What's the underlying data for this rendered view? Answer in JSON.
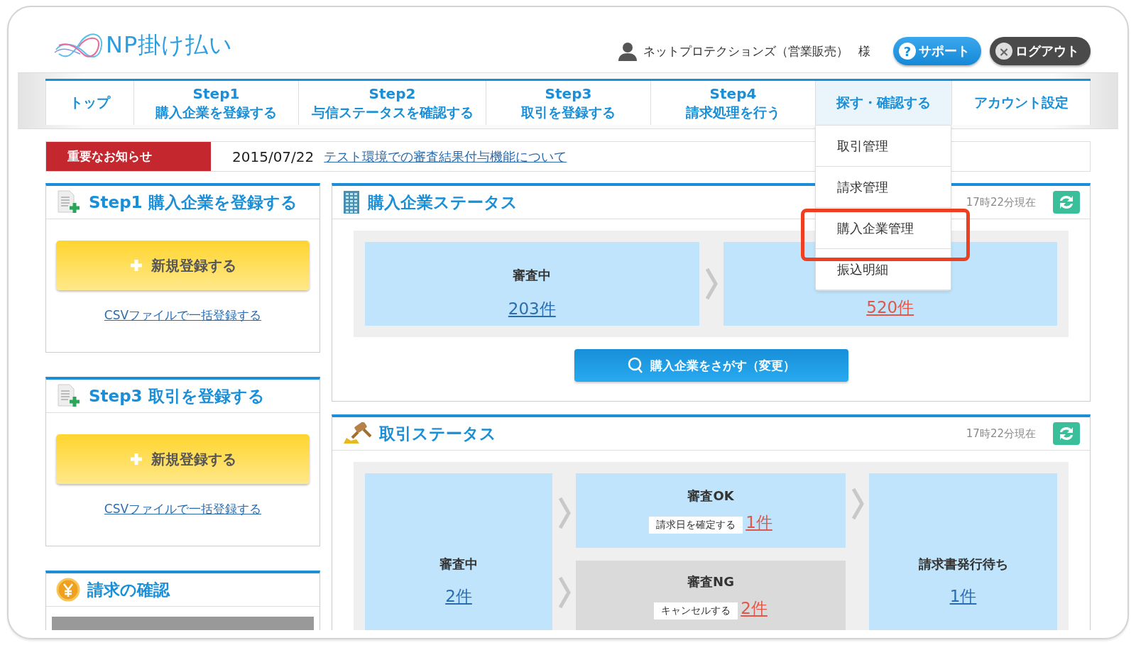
{
  "logo": {
    "text": "NP掛け払い"
  },
  "user": {
    "name": "ネットプロテクションズ（営業販売）",
    "honorific": "様"
  },
  "header_buttons": [
    {
      "kind": "support",
      "icon": "?",
      "label": "サポート"
    },
    {
      "kind": "logout",
      "icon": "×",
      "label": "ログアウト"
    }
  ],
  "nav": {
    "tabs": [
      {
        "label": "トップ",
        "selected": false
      },
      {
        "step": "Step1",
        "label": "購入企業を登録する",
        "selected": false
      },
      {
        "step": "Step2",
        "label": "与信ステータスを確認する",
        "selected": false
      },
      {
        "step": "Step3",
        "label": "取引を登録する",
        "selected": false
      },
      {
        "step": "Step4",
        "label": "請求処理を行う",
        "selected": false
      },
      {
        "label": "探す・確認する",
        "selected": true,
        "expanded": true
      },
      {
        "label": "アカウント設定",
        "selected": false
      }
    ]
  },
  "dropdown": {
    "items": [
      {
        "label": "取引管理",
        "highlighted": false
      },
      {
        "label": "請求管理",
        "highlighted": false
      },
      {
        "label": "購入企業管理",
        "highlighted": true
      },
      {
        "label": "振込明細",
        "highlighted": false
      }
    ]
  },
  "notice": {
    "badge": "重要なお知らせ",
    "date": "2015/07/22",
    "link": "テスト環境での審査結果付与機能について"
  },
  "left_cards": [
    {
      "kind": "register",
      "title": "Step1 購入企業を登録する",
      "button": "新規登録する",
      "link": "CSVファイルで一括登録する"
    },
    {
      "kind": "register",
      "title": "Step3 取引を登録する",
      "button": "新規登録する",
      "link": "CSVファイルで一括登録する"
    },
    {
      "kind": "billing",
      "title": "請求の確認"
    }
  ],
  "company_status": {
    "title": "購入企業ステータス",
    "time": "17時22分現在",
    "stages": [
      {
        "label": "審査中",
        "count": "203件",
        "alert": false
      },
      {
        "count": "520件",
        "alert": true
      }
    ],
    "search_button": "購入企業をさがす（変更）"
  },
  "deal_status": {
    "title": "取引ステータス",
    "time": "17時22分現在",
    "pending": {
      "label": "審査中",
      "count": "2件",
      "alert": false
    },
    "ok": {
      "label": "審査OK",
      "action": "請求日を確定する",
      "count": "1件",
      "alert": true
    },
    "ng": {
      "label": "審査NG",
      "action": "キャンセルする",
      "count": "2件",
      "alert": true
    },
    "awaiting": {
      "label": "請求書発行待ち",
      "count": "1件",
      "alert": false
    }
  }
}
